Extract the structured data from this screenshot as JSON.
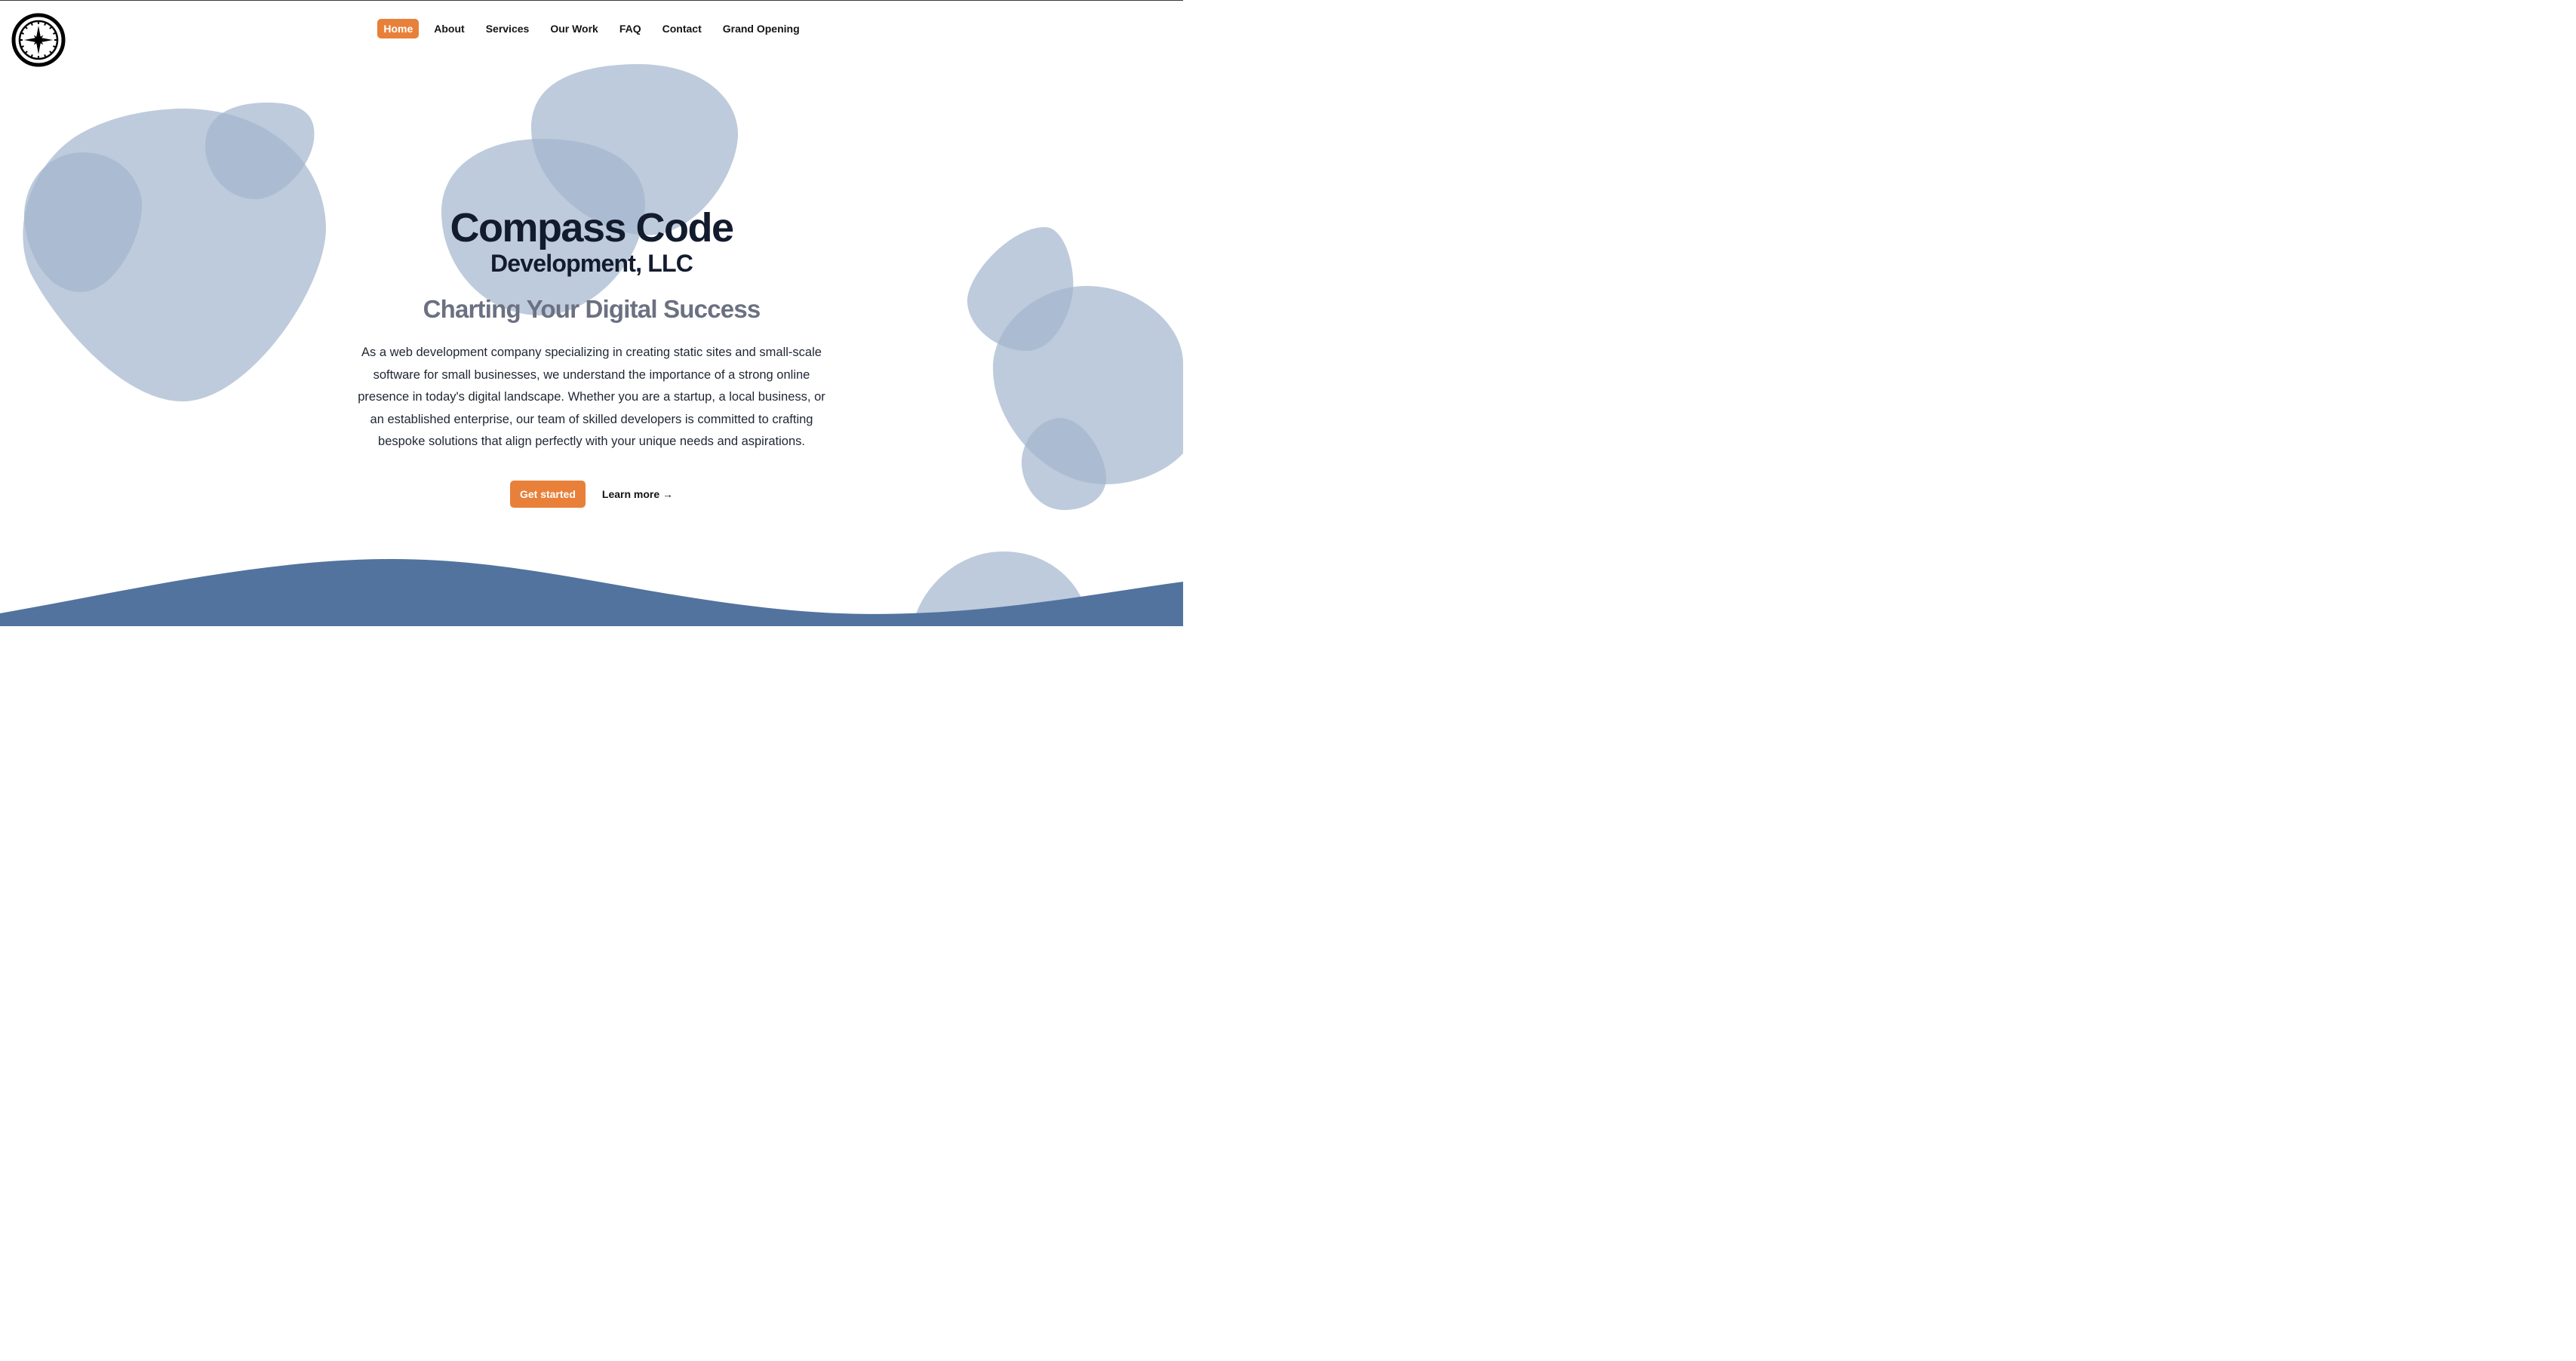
{
  "nav": {
    "items": [
      {
        "label": "Home",
        "active": true
      },
      {
        "label": "About"
      },
      {
        "label": "Services"
      },
      {
        "label": "Our Work"
      },
      {
        "label": "FAQ"
      },
      {
        "label": "Contact"
      },
      {
        "label": "Grand Opening"
      }
    ]
  },
  "hero": {
    "title": "Compass Code",
    "subtitle": "Development, LLC",
    "tagline": "Charting Your Digital Success",
    "description": "As a web development company specializing in creating static sites and small-scale software for small businesses, we understand the importance of a strong online presence in today's digital landscape. Whether you are a startup, a local business, or an established enterprise, our team of skilled developers is committed to crafting bespoke solutions that align perfectly with your unique needs and aspirations.",
    "primary_cta": "Get started",
    "secondary_cta": "Learn more →"
  },
  "logo": {
    "icon": "compass-icon"
  },
  "colors": {
    "accent": "#e8803a",
    "blob": "#a3b5cd",
    "wave": "#52739e",
    "heading": "#131b2e",
    "tagline": "#6b7182"
  }
}
